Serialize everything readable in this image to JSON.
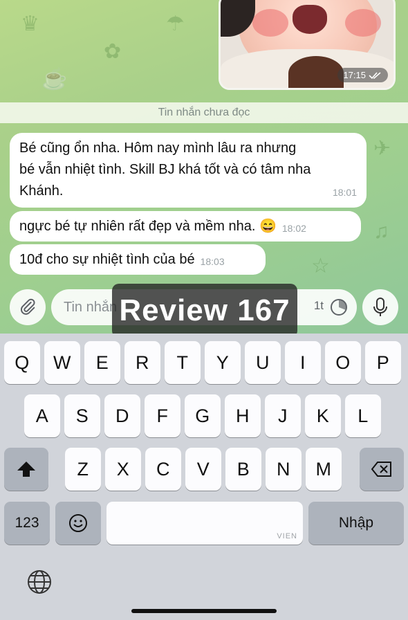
{
  "chat": {
    "photo_time": "17:15",
    "unread_label": "Tin nhắn chưa đọc",
    "messages": [
      {
        "text": "Bé cũng ổn nha. Hôm nay mình lâu ra nhưng\nbé vẫn nhiệt tình. Skill BJ khá tốt và có tâm nha\nKhánh.",
        "time": "18:01"
      },
      {
        "text": "ngực bé tự nhiên rất đẹp và mềm nha. 😄",
        "time": "18:02"
      },
      {
        "text": "10đ cho sự nhiệt tình của bé",
        "time": "18:03"
      }
    ]
  },
  "composer": {
    "placeholder": "Tin nhắn",
    "schedule_label": "1t"
  },
  "watermark": {
    "text": "Review 167"
  },
  "keyboard": {
    "row1": [
      "Q",
      "W",
      "E",
      "R",
      "T",
      "Y",
      "U",
      "I",
      "O",
      "P"
    ],
    "row2": [
      "A",
      "S",
      "D",
      "F",
      "G",
      "H",
      "J",
      "K",
      "L"
    ],
    "row3": [
      "Z",
      "X",
      "C",
      "V",
      "B",
      "N",
      "M"
    ],
    "numbers_label": "123",
    "space_hint": "VIEN",
    "return_label": "Nhập"
  },
  "colors": {
    "chat_bg": "#a9d08a",
    "bubble": "#ffffff",
    "key": "#fcfcfe",
    "key_dark": "#adb3bc"
  }
}
